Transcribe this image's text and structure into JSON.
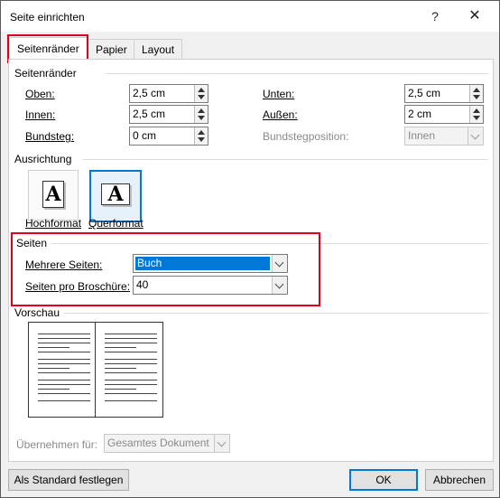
{
  "dialog": {
    "title": "Seite einrichten",
    "help_glyph": "?",
    "close_glyph": "✕"
  },
  "tabs": [
    {
      "label": "Seitenränder",
      "active": true
    },
    {
      "label": "Papier",
      "active": false
    },
    {
      "label": "Layout",
      "active": false
    }
  ],
  "margins": {
    "group_label": "Seitenränder",
    "top_label": "Oben:",
    "top_value": "2,5 cm",
    "bottom_label": "Unten:",
    "bottom_value": "2,5 cm",
    "inside_label": "Innen:",
    "inside_value": "2,5 cm",
    "outside_label": "Außen:",
    "outside_value": "2 cm",
    "gutter_label": "Bundsteg:",
    "gutter_value": "0 cm",
    "gutter_pos_label": "Bundstegposition:",
    "gutter_pos_value": "Innen"
  },
  "orientation": {
    "group_label": "Ausrichtung",
    "portrait_label": "Hochformat",
    "landscape_label": "Querformat",
    "icon_glyph": "A",
    "selected": "landscape"
  },
  "pages": {
    "group_label": "Seiten",
    "multiple_label": "Mehrere Seiten:",
    "multiple_value": "Buch",
    "per_booklet_label": "Seiten pro Broschüre:",
    "per_booklet_value": "40"
  },
  "preview": {
    "group_label": "Vorschau"
  },
  "apply": {
    "label": "Übernehmen für:",
    "value": "Gesamtes Dokument"
  },
  "buttons": {
    "default_label": "Als Standard festlegen",
    "ok_label": "OK",
    "cancel_label": "Abbrechen"
  },
  "colors": {
    "accent": "#0078d7",
    "highlight_box": "#e0001b"
  }
}
